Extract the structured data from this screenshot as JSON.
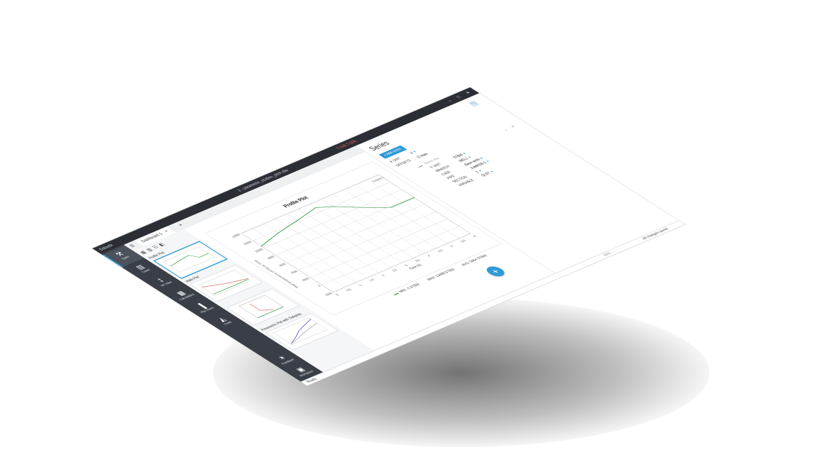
{
  "app": {
    "name": "Ecloudx",
    "window_title": "2 - parametric_studies_pitch.dlw",
    "window_badge": "T-196 T-196"
  },
  "window_controls": {
    "minimize": "–",
    "maximize": "□",
    "close": "✕"
  },
  "rail": {
    "items": [
      {
        "label": "Tasks",
        "icon": "tasks-icon",
        "glyph": "⚒"
      },
      {
        "label": "Cases",
        "icon": "cases-icon",
        "glyph": "▤"
      },
      {
        "label": "WT Files",
        "icon": "thermometer-icon",
        "glyph": "‡"
      },
      {
        "label": "Calculations",
        "icon": "calculator-icon",
        "glyph": "▦"
      },
      {
        "label": "Plot Views",
        "icon": "bar-chart-icon",
        "glyph": "▐"
      },
      {
        "label": "Costs",
        "icon": "costs-icon",
        "glyph": "◭"
      }
    ],
    "bottom": [
      {
        "label": "Feedback",
        "icon": "lightbulb-icon",
        "glyph": "☀"
      },
      {
        "label": "Workspace",
        "icon": "briefcase-icon",
        "glyph": "▣"
      }
    ]
  },
  "tabs": {
    "menu_icon": "☰",
    "active": "Dashboard 1",
    "close": "✕",
    "add": "+"
  },
  "thumbnails": [
    {
      "title": "Profile Plot",
      "selected": true
    },
    {
      "title": "Walk Plot",
      "selected": false
    },
    {
      "title": "",
      "selected": false
    },
    {
      "title": "Parametric Plot with Subplots",
      "selected": false
    }
  ],
  "plot": {
    "title": "Profile Plot",
    "xlabel": "Time (h)",
    "ylabel": "Wall temperature (ST8) vs Time",
    "legend_note": "Subplot 1",
    "legend": {
      "min": "MIN: -1 STB/d",
      "max": "MAX: 13088 STB/d",
      "avg": "AVG: 5464 STB/d"
    }
  },
  "chart_data": {
    "type": "line",
    "title": "Profile Plot",
    "xlabel": "Time (h)",
    "ylabel": "Wall temperature (ST8) vs Time",
    "xlim": [
      0,
      6
    ],
    "ylim": [
      -2000,
      14000
    ],
    "xticks": [
      0,
      0.5,
      1,
      1.5,
      2,
      2.5,
      3,
      3.5,
      4,
      4.5,
      5,
      5.5,
      6
    ],
    "yticks": [
      -2000,
      0,
      2000,
      4000,
      6000,
      8000,
      10000,
      12000,
      14000
    ],
    "grid": true,
    "series": [
      {
        "color": "#3aa04a",
        "x": [
          0,
          0.5,
          1,
          2,
          3,
          3.5,
          4,
          4.5,
          5,
          6
        ],
        "y": [
          10500,
          11000,
          11500,
          12200,
          13000,
          12000,
          10500,
          9000,
          7800,
          7800
        ]
      }
    ]
  },
  "series_panel": {
    "title": "Series",
    "add_button": "+ Add series",
    "fields": [
      {
        "label": "X UNIT",
        "value": "h"
      },
      {
        "label": "OFFSETS",
        "value": "Auto"
      }
    ],
    "series_title_placeholder": "Series title",
    "props": [
      {
        "label": "Y UNIT",
        "value": "STB/d"
      },
      {
        "label": "BRANCH",
        "value": "WELL"
      },
      {
        "label": "CASE",
        "value": "Base wells"
      },
      {
        "label": "PIPE",
        "value": "JUMPER-1"
      },
      {
        "label": "SECTION",
        "value": "1"
      },
      {
        "label": "VARIABLE",
        "value": "QLST"
      }
    ]
  },
  "status": {
    "left": "Ready",
    "right": "All changes saved",
    "zoom": "63%"
  }
}
